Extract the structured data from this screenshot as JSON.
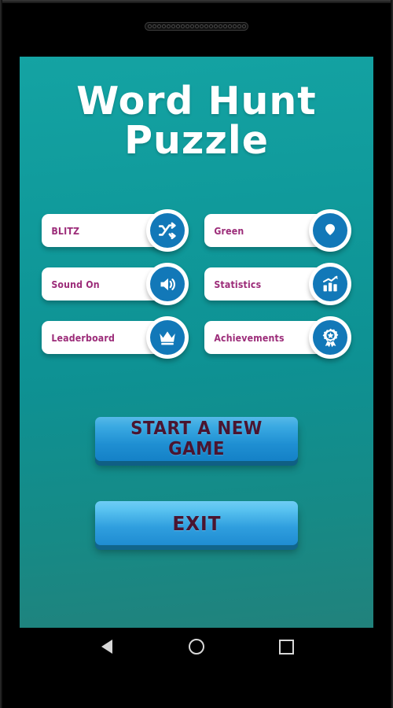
{
  "app": {
    "title_line1": "Word Hunt",
    "title_line2": "Puzzle"
  },
  "menu": {
    "items": [
      {
        "label": "BLITZ",
        "icon": "shuffle-icon"
      },
      {
        "label": "Green",
        "icon": "theme-shield-icon"
      },
      {
        "label": "Sound On",
        "icon": "speaker-on-icon"
      },
      {
        "label": "Statistics",
        "icon": "bar-chart-icon"
      },
      {
        "label": "Leaderboard",
        "icon": "crown-icon"
      },
      {
        "label": "Achievements",
        "icon": "medal-rosette-icon"
      }
    ]
  },
  "actions": {
    "start_label": "START A NEW GAME",
    "exit_label": "EXIT"
  },
  "navbar": {
    "back": "back-icon",
    "home": "home-icon",
    "recents": "recents-icon"
  },
  "colors": {
    "screen_top": "#14a3a3",
    "screen_bottom": "#21827c",
    "menu_label": "#9c2c79",
    "icon_circle": "#1278b8",
    "action_text": "#4a1530",
    "title_text": "#ffffff"
  }
}
